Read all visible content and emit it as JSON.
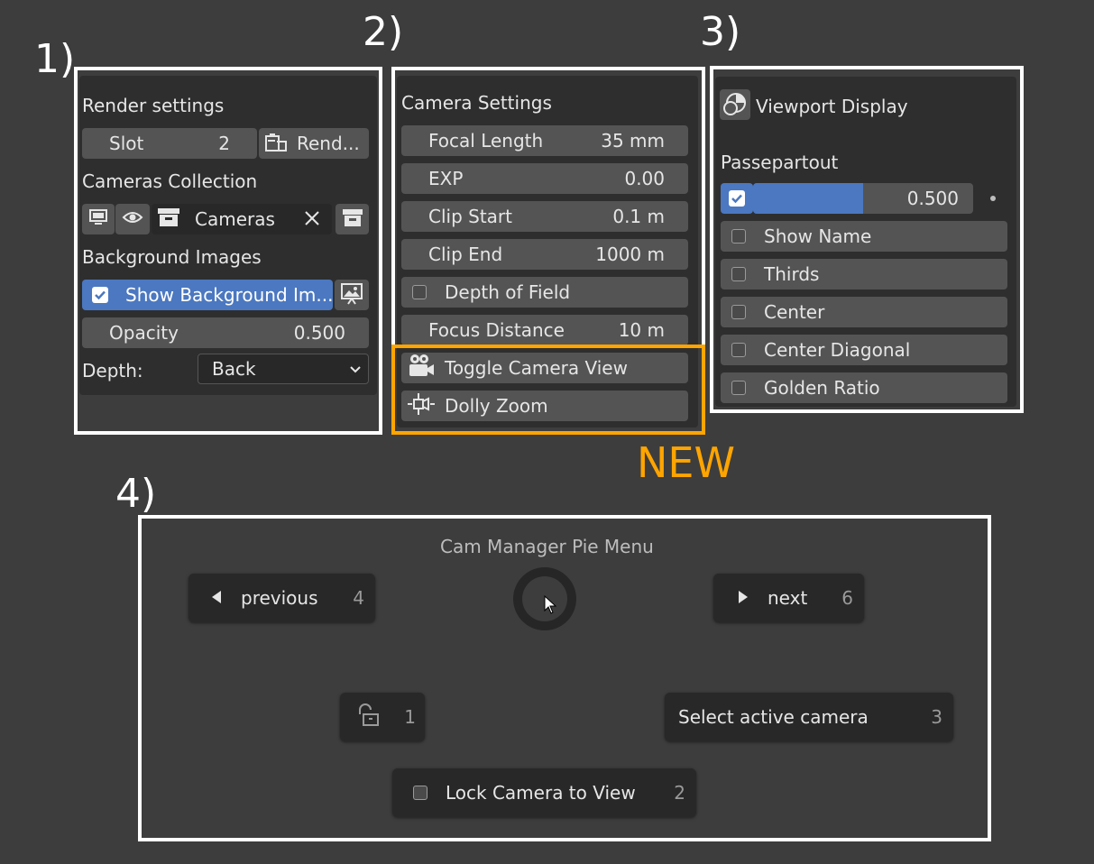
{
  "labels": {
    "one": "1)",
    "two": "2)",
    "three": "3)",
    "four": "4)",
    "new_badge": "NEW"
  },
  "colors": {
    "frame": "#ffffff",
    "highlight_frame": "#ffa500",
    "accent_blue": "#4b78c0",
    "background": "#3d3d3d"
  },
  "render_panel": {
    "render_settings": "Render settings",
    "slot_label": "Slot",
    "slot_value": "2",
    "render_button": "Rend...",
    "cameras_collection": "Cameras Collection",
    "collection_name": "Cameras",
    "background_images": "Background Images",
    "show_background": "Show Background Im...",
    "opacity_label": "Opacity",
    "opacity_value": "0.500",
    "depth_label": "Depth:",
    "depth_value": "Back"
  },
  "camera_panel": {
    "title": "Camera Settings",
    "focal_length_label": "Focal Length",
    "focal_length_value": "35 mm",
    "exp_label": "EXP",
    "exp_value": "0.00",
    "clip_start_label": "Clip Start",
    "clip_start_value": "0.1 m",
    "clip_end_label": "Clip End",
    "clip_end_value": "1000 m",
    "dof_label": "Depth of Field",
    "focus_distance_label": "Focus Distance",
    "focus_distance_value": "10 m",
    "toggle_camera_view": "Toggle Camera View",
    "dolly_zoom": "Dolly Zoom"
  },
  "viewport_panel": {
    "title": "Viewport Display",
    "passepartout_label": "Passepartout",
    "passepartout_value": "0.500",
    "passepartout_fraction": 0.5,
    "options": [
      "Show Name",
      "Thirds",
      "Center",
      "Center Diagonal",
      "Golden Ratio"
    ]
  },
  "pie_menu": {
    "title": "Cam Manager Pie Menu",
    "previous_label": "previous",
    "previous_key": "4",
    "next_label": "next",
    "next_key": "6",
    "lock_key": "1",
    "select_active": "Select active camera",
    "select_key": "3",
    "lock_camera": "Lock Camera to View",
    "lock_camera_key": "2"
  }
}
